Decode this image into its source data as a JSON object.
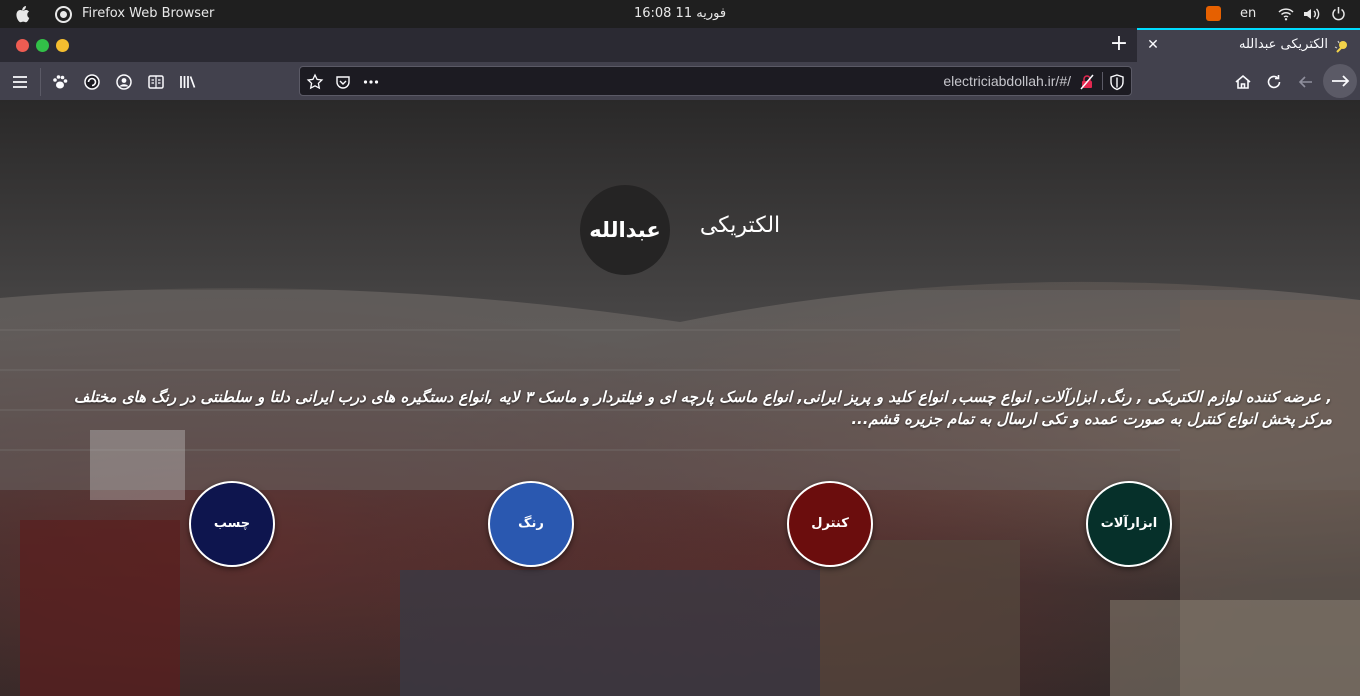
{
  "os": {
    "app_name": "Firefox Web Browser",
    "clock": "16:08  11 فوریه",
    "lang": "en"
  },
  "browser": {
    "tab_title": "الکتریکی عبدالله",
    "new_tab": "+",
    "tab_close": "✕",
    "url": "electriciabdollah.ir/#/",
    "accent_color": "#00ddff"
  },
  "site": {
    "brand_circle": "عبدالله",
    "brand_text": "الکتریکی",
    "description_line1": ", عرضه کننده لوازم الکتریکی , رنگ, ابزارآلات, انواع چسب, انواع کلید و پریز ایرانی, انواع ماسک پارچه ای و فیلتردار و ماسک ۳ لایه ,انواع دستگیره های درب ایرانی دلتا و سلطنتی در رنگ های مختلف",
    "description_line2": "مرکز پخش انواع کنترل به صورت عمده و تکی ارسال به تمام جزیره قشم...",
    "categories": [
      {
        "label": "چسب",
        "color": "#0e154e"
      },
      {
        "label": "رنگ",
        "color": "#2a58b0"
      },
      {
        "label": "کنترل",
        "color": "#6b0d0d"
      },
      {
        "label": "ابزارآلات",
        "color": "#06302a"
      }
    ]
  }
}
